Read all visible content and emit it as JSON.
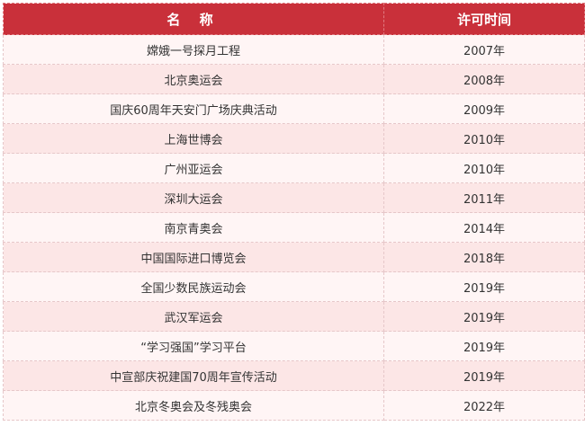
{
  "table": {
    "headers": {
      "name": "名 称",
      "year": "许可时间"
    },
    "rows": [
      {
        "name": "嫦娥一号探月工程",
        "year": "2007年"
      },
      {
        "name": "北京奥运会",
        "year": "2008年"
      },
      {
        "name": "国庆60周年天安门广场庆典活动",
        "year": "2009年"
      },
      {
        "name": "上海世博会",
        "year": "2010年"
      },
      {
        "name": "广州亚运会",
        "year": "2010年"
      },
      {
        "name": "深圳大运会",
        "year": "2011年"
      },
      {
        "name": "南京青奥会",
        "year": "2014年"
      },
      {
        "name": "中国国际进口博览会",
        "year": "2018年"
      },
      {
        "name": "全国少数民族运动会",
        "year": "2019年"
      },
      {
        "name": "武汉军运会",
        "year": "2019年"
      },
      {
        "name": "“学习强国”学习平台",
        "year": "2019年"
      },
      {
        "name": "中宣部庆祝建国70周年宣传活动",
        "year": "2019年"
      },
      {
        "name": "北京冬奥会及冬残奥会",
        "year": "2022年"
      }
    ]
  },
  "colors": {
    "header_bg": "#c9303a",
    "row_light": "#fff5f5",
    "row_dark": "#fce6e6"
  }
}
